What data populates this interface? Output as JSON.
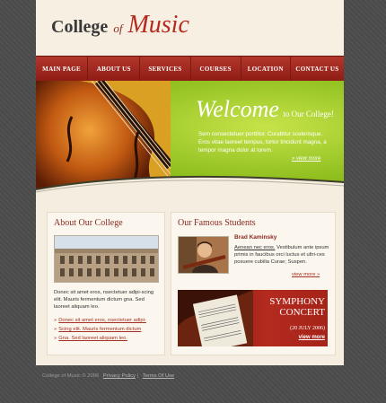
{
  "logo": {
    "word1": "College",
    "word2": "of",
    "word3": "Music"
  },
  "nav": {
    "items": [
      {
        "label": "MAIN PAGE"
      },
      {
        "label": "ABOUT US"
      },
      {
        "label": "SERVICES"
      },
      {
        "label": "COURSES"
      },
      {
        "label": "LOCATION"
      },
      {
        "label": "CONTACT US"
      }
    ]
  },
  "hero": {
    "welcome": "Welcome",
    "welcome_sub": "to Our College!",
    "text": "Sem consectetuer porttitor. Curabitur scelerisque. Eros vitae laoreet tempus, tortor tincidunt magna, a tempor magna dolor at lorem.",
    "more": "view more"
  },
  "about": {
    "title": "About Our College",
    "text": "Donec sit amet eros, nsectetuer adipi-scing elit. Mauris fermentum dictum gna. Sed laoreet aliquam leo.",
    "links": [
      {
        "label": "Donec sit amet eros, nsectetuer adipi-"
      },
      {
        "label": "Scing elit. Mauris fermentum dictum"
      },
      {
        "label": "Gna. Sed laoreet aliquam leo."
      }
    ]
  },
  "students": {
    "title": "Our Famous Students",
    "name": "Brad Kaminsky",
    "text_link": "Aenean nec eros.",
    "text": " Vestibulum ante ipsum primis in faucibus orci luctus et ultri-ces posuere cubilia Curae; Suspen.",
    "more": "view more"
  },
  "concert": {
    "title1": "SYMPHONY",
    "title2": "CONCERT",
    "date": "(20 JULY 2006)",
    "more": "view more"
  },
  "footer": {
    "copyright": "College of Music © 2006",
    "privacy": "Privacy Policy",
    "terms": "Terms Of Use"
  }
}
